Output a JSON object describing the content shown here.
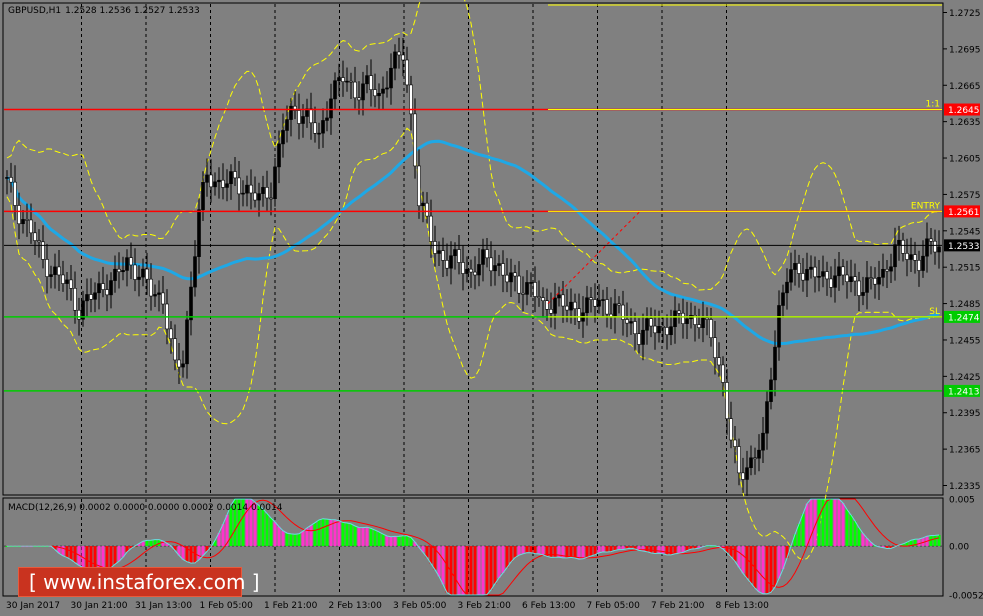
{
  "header": {
    "symbol": "GBPUSD,H1",
    "ohlc": "1.2528 1.2536 1.2527 1.2533"
  },
  "macd_header": "MACD(12,26,9) 0.0002 0.0000 0.0000 0.0002 0.0014 0.0014",
  "watermark": {
    "text": "[ www.instaforex.com ]"
  },
  "price_axis": {
    "ticks": [
      "1.2725",
      "1.2695",
      "1.2665",
      "1.2635",
      "1.2605",
      "1.2575",
      "1.2545",
      "1.2515",
      "1.2485",
      "1.2455",
      "1.2425",
      "1.2395",
      "1.2365",
      "1.2335"
    ]
  },
  "macd_axis": {
    "ticks": [
      "0.005",
      "0.00",
      "-0.0052"
    ]
  },
  "time_axis": {
    "labels": [
      "30 Jan 2017",
      "30 Jan 21:00",
      "31 Jan 13:00",
      "1 Feb 05:00",
      "1 Feb 21:00",
      "2 Feb 13:00",
      "3 Feb 05:00",
      "3 Feb 21:00",
      "6 Feb 13:00",
      "7 Feb 05:00",
      "7 Feb 21:00",
      "8 Feb 13:00"
    ]
  },
  "levels": [
    {
      "name": "tp",
      "label": "1:1",
      "tag": "1.2645",
      "price": 1.2645,
      "color": "#ff0000",
      "tag_bg": "#ff0000",
      "tag_fg": "#ffffff"
    },
    {
      "name": "entry",
      "label": "ENTRY",
      "tag": "1.2561",
      "price": 1.2561,
      "color": "#ff0000",
      "tag_bg": "#ff0000",
      "tag_fg": "#ffffff"
    },
    {
      "name": "current",
      "label": "",
      "tag": "1.2533",
      "price": 1.2533,
      "color": "#000000",
      "tag_bg": "#000000",
      "tag_fg": "#ffffff"
    },
    {
      "name": "sl",
      "label": "SL",
      "tag": "1.2474",
      "price": 1.2474,
      "color": "#00cc00",
      "tag_bg": "#00cc00",
      "tag_fg": "#ffffff"
    },
    {
      "name": "support",
      "label": "",
      "tag": "1.2413",
      "price": 1.2413,
      "color": "#00cc00",
      "tag_bg": "#00cc00",
      "tag_fg": "#ffffff"
    }
  ],
  "colors": {
    "background": "#808080",
    "candle": "#000000",
    "bollinger": "#ffff00",
    "ma": "#1ea8e6",
    "macd_pos": "#00ff00",
    "macd_neg": "#ff0000",
    "macd_pink": "#ff33cc",
    "signal": "#ff0000",
    "macd_line": "#66e0e0"
  },
  "chart_data": {
    "type": "candlestick",
    "symbol": "GBPUSD",
    "timeframe": "H1",
    "ylim": [
      1.2328,
      1.2732
    ],
    "macd_ylim": [
      -0.0052,
      0.005
    ],
    "x": [
      "30 Jan 2017",
      "30 Jan 21:00",
      "31 Jan 13:00",
      "1 Feb 05:00",
      "1 Feb 21:00",
      "2 Feb 13:00",
      "3 Feb 05:00",
      "3 Feb 21:00",
      "6 Feb 13:00",
      "7 Feb 05:00",
      "7 Feb 21:00",
      "8 Feb 13:00"
    ],
    "close_path": [
      [
        0,
        1.2585
      ],
      [
        3,
        1.256
      ],
      [
        6,
        1.2545
      ],
      [
        9,
        1.252
      ],
      [
        12,
        1.251
      ],
      [
        15,
        1.25
      ],
      [
        18,
        1.248
      ],
      [
        21,
        1.249
      ],
      [
        24,
        1.25
      ],
      [
        27,
        1.2505
      ],
      [
        30,
        1.252
      ],
      [
        33,
        1.251
      ],
      [
        36,
        1.2495
      ],
      [
        39,
        1.249
      ],
      [
        40,
        1.247
      ],
      [
        42,
        1.243
      ],
      [
        44,
        1.244
      ],
      [
        46,
        1.25
      ],
      [
        48,
        1.256
      ],
      [
        50,
        1.259
      ],
      [
        53,
        1.2585
      ],
      [
        56,
        1.2585
      ],
      [
        60,
        1.258
      ],
      [
        63,
        1.257
      ],
      [
        66,
        1.258
      ],
      [
        69,
        1.263
      ],
      [
        72,
        1.2645
      ],
      [
        75,
        1.264
      ],
      [
        78,
        1.262
      ],
      [
        81,
        1.266
      ],
      [
        84,
        1.267
      ],
      [
        87,
        1.266
      ],
      [
        90,
        1.2665
      ],
      [
        93,
        1.2655
      ],
      [
        96,
        1.268
      ],
      [
        99,
        1.269
      ],
      [
        101,
        1.264
      ],
      [
        103,
        1.257
      ],
      [
        105,
        1.255
      ],
      [
        107,
        1.253
      ],
      [
        110,
        1.252
      ],
      [
        113,
        1.252
      ],
      [
        116,
        1.251
      ],
      [
        119,
        1.252
      ],
      [
        122,
        1.252
      ],
      [
        125,
        1.2505
      ],
      [
        128,
        1.25
      ],
      [
        131,
        1.25
      ],
      [
        134,
        1.248
      ],
      [
        137,
        1.249
      ],
      [
        140,
        1.248
      ],
      [
        143,
        1.248
      ],
      [
        146,
        1.2485
      ],
      [
        149,
        1.2485
      ],
      [
        152,
        1.248
      ],
      [
        155,
        1.247
      ],
      [
        158,
        1.246
      ],
      [
        161,
        1.2465
      ],
      [
        164,
        1.2465
      ],
      [
        167,
        1.247
      ],
      [
        170,
        1.2475
      ],
      [
        173,
        1.247
      ],
      [
        176,
        1.246
      ],
      [
        179,
        1.242
      ],
      [
        181,
        1.237
      ],
      [
        183,
        1.2345
      ],
      [
        186,
        1.2355
      ],
      [
        189,
        1.237
      ],
      [
        191,
        1.243
      ],
      [
        193,
        1.248
      ],
      [
        195,
        1.2505
      ],
      [
        198,
        1.2515
      ],
      [
        201,
        1.251
      ],
      [
        204,
        1.2505
      ],
      [
        207,
        1.251
      ],
      [
        210,
        1.2505
      ],
      [
        213,
        1.25
      ],
      [
        216,
        1.25
      ],
      [
        219,
        1.251
      ],
      [
        222,
        1.253
      ],
      [
        225,
        1.2525
      ],
      [
        228,
        1.252
      ],
      [
        231,
        1.2533
      ]
    ],
    "indicators": [
      "Bollinger Bands",
      "Moving Average",
      "MACD(12,26,9)"
    ]
  }
}
